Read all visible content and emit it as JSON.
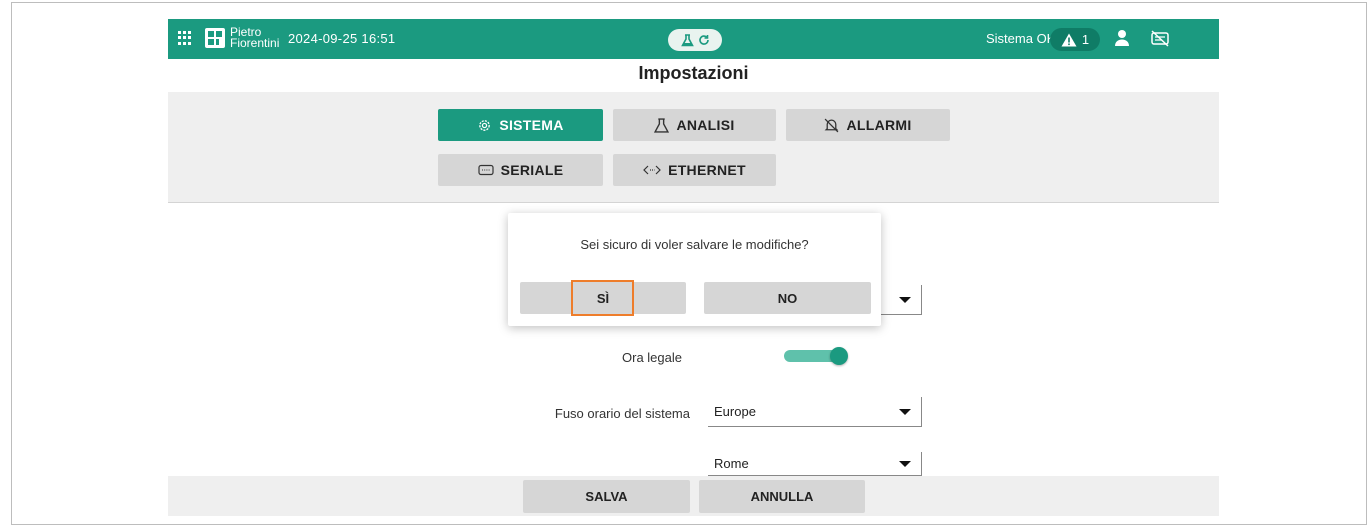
{
  "header": {
    "brand_line1": "Pietro",
    "brand_line2": "Fiorentini",
    "datetime": "2024-09-25 16:51",
    "system_status": "Sistema OK",
    "alarm_count": "1"
  },
  "page": {
    "title": "Impostazioni"
  },
  "tabs": [
    {
      "label": "SISTEMA",
      "icon": "gear-icon",
      "active": true
    },
    {
      "label": "ANALISI",
      "icon": "flask-icon",
      "active": false
    },
    {
      "label": "ALLARMI",
      "icon": "bell-off-icon",
      "active": false
    },
    {
      "label": "SERIALE",
      "icon": "serial-port-icon",
      "active": false
    },
    {
      "label": "ETHERNET",
      "icon": "ethernet-icon",
      "active": false
    }
  ],
  "form": {
    "dst_label": "Ora legale",
    "dst_on": true,
    "timezone_label": "Fuso orario del sistema",
    "region_value": "Europe",
    "city_value": "Rome"
  },
  "footer": {
    "save_label": "SALVA",
    "cancel_label": "ANNULLA"
  },
  "dialog": {
    "message": "Sei sicuro di voler salvare le modifiche?",
    "yes_label": "SÌ",
    "no_label": "NO"
  },
  "colors": {
    "accent": "#1b9a80",
    "highlight": "#ee7d2b"
  }
}
